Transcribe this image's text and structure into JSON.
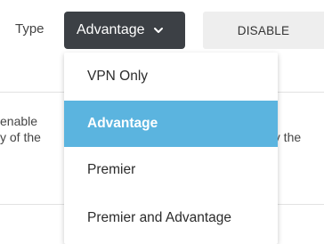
{
  "type_field": {
    "label": "Type",
    "selected_value": "Advantage"
  },
  "disable_button": {
    "label": "DISABLE"
  },
  "background_text": {
    "line1_left": "enable",
    "line1_right": "at",
    "line2_left": "y of the",
    "line2_right": "by the"
  },
  "dropdown": {
    "options": [
      "VPN Only",
      "Advantage",
      "Premier",
      "Premier and Advantage"
    ],
    "selected_index": 1
  },
  "colors": {
    "select_bg": "#3c4045",
    "selected_option_bg": "#5bb4df",
    "disable_bg": "#eeeeee"
  },
  "icons": {
    "select_chevron": "chevron-down-icon"
  }
}
